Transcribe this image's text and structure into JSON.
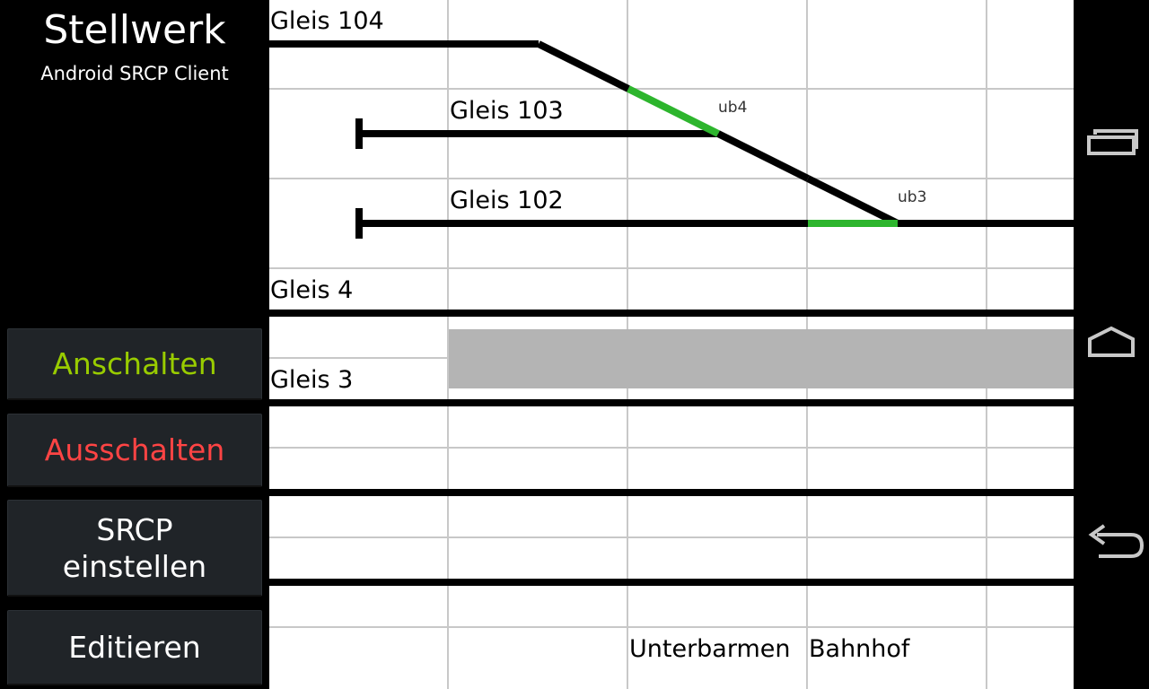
{
  "app": {
    "title": "Stellwerk",
    "subtitle": "Android SRCP Client"
  },
  "buttons": {
    "on_label": "Anschalten",
    "off_label": "Ausschalten",
    "srcp_label_line1": "SRCP",
    "srcp_label_line2": "einstellen",
    "edit_label": "Editieren"
  },
  "track_labels": {
    "gleis_104": "Gleis 104",
    "gleis_103": "Gleis 103",
    "gleis_102": "Gleis 102",
    "gleis_4": "Gleis 4",
    "gleis_3": "Gleis 3"
  },
  "turnouts": {
    "ub4": "ub4",
    "ub3": "ub3"
  },
  "station_labels": {
    "unterbarmen": "Unterbarmen",
    "bahnhof": "Bahnhof"
  },
  "colors": {
    "on_green": "#99cc00",
    "off_red": "#ff4444",
    "route_green": "#2db52d",
    "occupied_gray": "#b4b4b4",
    "track_black": "#000000",
    "grid_gray": "#c8c8c8"
  },
  "navigation": {
    "recent_icon": "recent-apps-icon",
    "home_icon": "home-icon",
    "back_icon": "back-icon"
  }
}
